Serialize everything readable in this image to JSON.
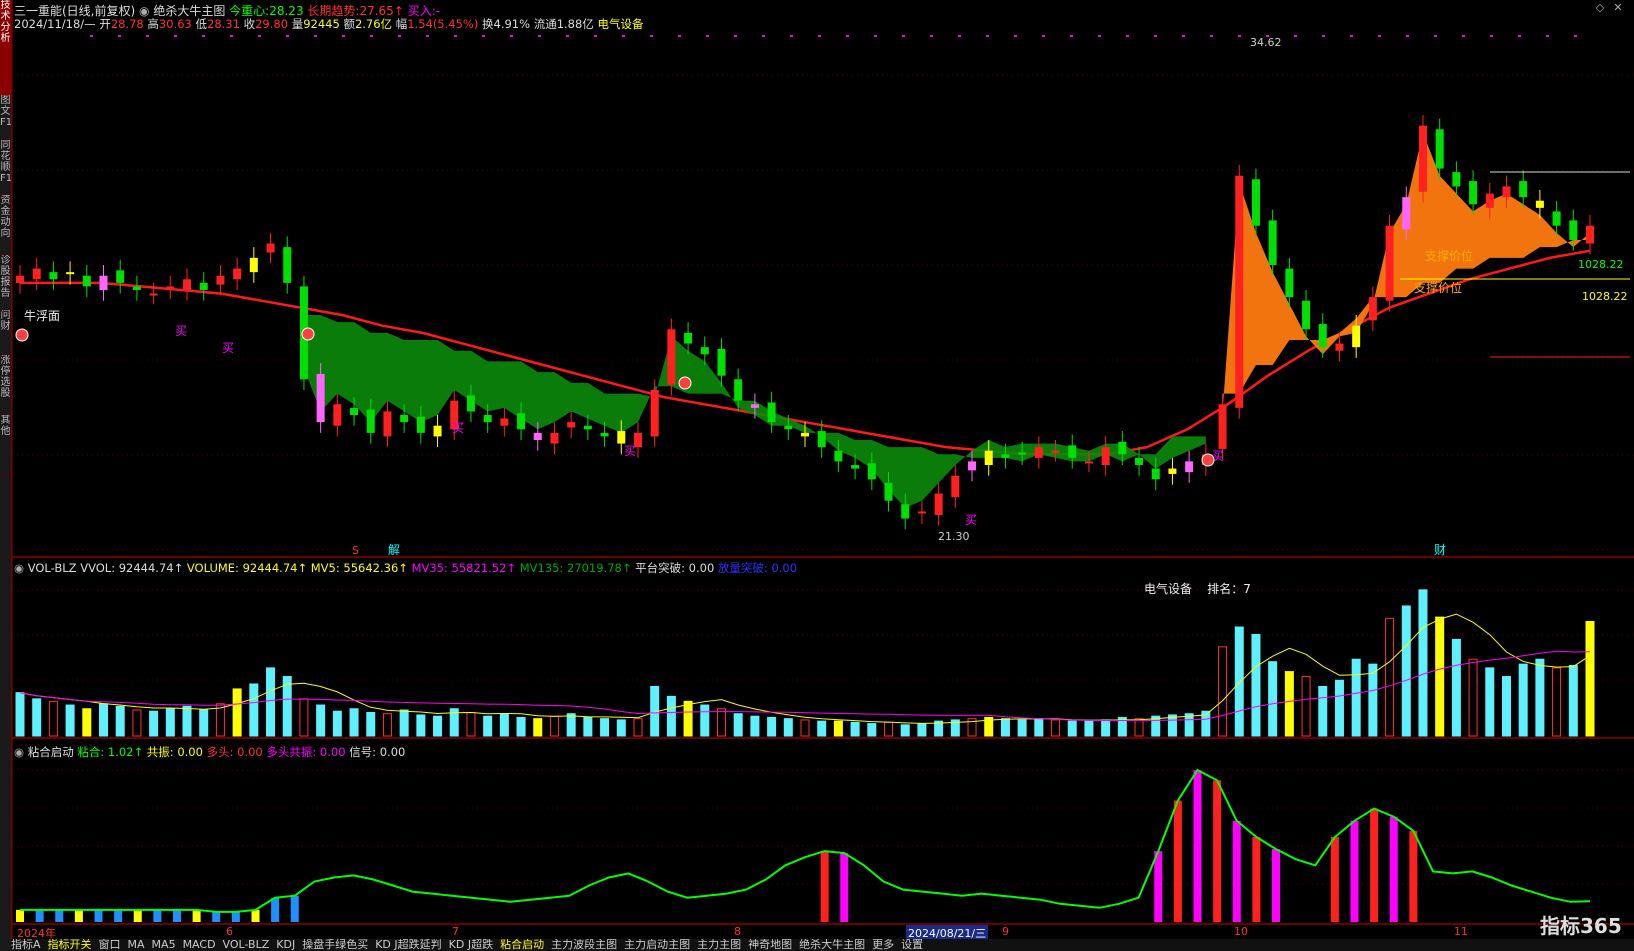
{
  "sidebar": {
    "tabs": [
      "技术分析",
      "图文F10",
      "同花顺F10",
      "资金动向",
      "诊股报告",
      "问财",
      "涨停选股",
      "其他"
    ]
  },
  "header": {
    "stock": "三一重能(日线,前复权)",
    "formula": "绝杀大牛主图",
    "today_label": "今重心:",
    "today_value": "28.23",
    "long_label": "长期趋势:",
    "long_value": "27.65↑",
    "buy_label": "买入:-",
    "line2": {
      "date": "2024/11/18/—",
      "open_l": "开",
      "open": "28.78",
      "high_l": "高",
      "high": "30.63",
      "low_l": "低",
      "low": "28.31",
      "close_l": "收",
      "close": "29.80",
      "vol_l": "量",
      "vol": "92445",
      "amt_l": "额",
      "amt": "2.76亿",
      "chg_l": "幅",
      "chg": "1.54(5.45%)",
      "turn": "换4.91%",
      "float": "流通1.88亿",
      "industry": "电气设备"
    }
  },
  "main_labels": {
    "high_mark": "34.62",
    "low_mark": "21.30",
    "price1": "1028.22",
    "price2": "1028.22",
    "support1": "支撑价位",
    "support2": "支撑价位",
    "niu": "牛浮面",
    "buy": "买",
    "jie": "解",
    "cai": "财",
    "s": "S"
  },
  "vol_panel": {
    "name": "VOL-BLZ",
    "vvol": "VVOL: 92444.74↑",
    "volume": "VOLUME: 92444.74↑",
    "mv5": "MV5: 55642.36↑",
    "mv35": "MV35: 55821.52↑",
    "mv135": "MV135: 27019.78↑",
    "ping": "平台突破: 0.00",
    "jiu": "放量突破: 0.00",
    "sector": "电气设备",
    "rank": "排名：7"
  },
  "ind_panel": {
    "name": "粘合启动",
    "nianhe": "粘合: 1.02↑",
    "gongzhen": "共振: 0.00",
    "duotou": "多头: 0.00",
    "duotougz": "多头共振: 0.00",
    "xinhao": "信号: 0.00"
  },
  "xaxis": {
    "labels": [
      "2024年",
      "6",
      "7",
      "8",
      "2024/08/21/三",
      "9",
      "10",
      "11"
    ]
  },
  "logo": "指标365",
  "bottom_tabs": [
    "指标A",
    "指标开关",
    "窗口",
    "MA",
    "MA5",
    "MACD",
    "VOL-BLZ",
    "KDJ",
    "操盘手绿色买",
    "KD J超跌延判",
    "KD J超跌",
    "粘合启动",
    "主力波段主图",
    "主力启动主图",
    "主力主图",
    "神奇地图",
    "绝杀大牛主图",
    "更多",
    "设置"
  ],
  "chart_data": [
    {
      "type": "candlestick",
      "title": "",
      "series": [
        {
          "name": "close",
          "values": [
            28.4,
            28.6,
            28.3,
            28.5,
            28.1,
            28.4,
            28.2,
            28.0,
            27.9,
            28.1,
            28.3,
            28.0,
            28.4,
            28.6,
            28.9,
            29.3,
            28.2,
            25.5,
            24.3,
            24.8,
            24.5,
            24.0,
            24.6,
            24.3,
            24.0,
            24.2,
            24.9,
            24.6,
            24.3,
            24.4,
            24.1,
            23.8,
            24.0,
            24.3,
            24.1,
            23.9,
            23.7,
            24.0,
            25.2,
            26.9,
            26.5,
            26.2,
            25.6,
            24.9,
            24.7,
            24.3,
            24.1,
            23.9,
            23.6,
            23.2,
            23.0,
            22.7,
            22.1,
            21.6,
            21.8,
            22.3,
            22.8,
            23.2,
            23.5,
            23.3,
            23.4,
            23.6,
            23.5,
            23.3,
            23.2,
            23.6,
            23.4,
            23.1,
            22.7,
            23.0,
            23.2,
            23.4,
            24.8,
            31.2,
            29.8,
            28.7,
            27.8,
            26.9,
            26.4,
            26.5,
            27.0,
            27.8,
            29.8,
            30.6,
            32.6,
            31.4,
            30.9,
            30.4,
            30.7,
            30.9,
            30.6,
            30.3,
            29.8,
            29.4,
            29.8
          ]
        },
        {
          "name": "MA",
          "values": [
            28.2,
            28.2,
            28.2,
            28.1,
            28.0,
            27.9,
            27.7,
            27.5,
            27.3,
            27.0,
            26.8,
            26.5,
            26.2,
            25.9,
            25.6,
            25.3,
            25.0,
            24.8,
            24.6,
            24.4,
            24.2,
            24.0,
            23.8,
            23.6,
            23.5,
            23.4,
            23.4,
            23.4,
            23.6,
            24.1,
            24.8,
            25.6,
            26.3,
            26.9,
            27.5,
            27.9,
            28.3,
            28.6,
            28.9,
            29.1
          ]
        }
      ],
      "ymin": 21.0,
      "ymax": 35.0
    },
    {
      "type": "bar",
      "title": "",
      "series": [
        {
          "name": "VOLUME",
          "values": [
            35000,
            30000,
            28000,
            25000,
            22000,
            26000,
            24000,
            21000,
            20000,
            22000,
            24000,
            21000,
            26000,
            38000,
            42000,
            55000,
            48000,
            30000,
            25000,
            20000,
            22000,
            19000,
            18000,
            21000,
            17000,
            16000,
            22000,
            19000,
            16000,
            18000,
            15000,
            14000,
            16000,
            18000,
            15000,
            14000,
            13000,
            14000,
            40000,
            32000,
            28000,
            25000,
            22000,
            18000,
            16000,
            15000,
            14000,
            13000,
            12000,
            12000,
            11000,
            10000,
            11000,
            9000,
            10000,
            12000,
            13000,
            14000,
            15000,
            14000,
            13000,
            14000,
            13000,
            12000,
            12000,
            13000,
            15000,
            14000,
            16000,
            17000,
            18000,
            20000,
            72000,
            88000,
            82000,
            60000,
            52000,
            48000,
            40000,
            45000,
            62000,
            58000,
            95000,
            105000,
            118000,
            96000,
            78000,
            62000,
            55000,
            48000,
            58000,
            62000,
            55000,
            57000,
            92445
          ]
        }
      ],
      "ymin": 0,
      "ymax": 130000
    },
    {
      "type": "bar",
      "title": "",
      "series": [
        {
          "name": "粘合",
          "values": [
            0.6,
            0.6,
            0.6,
            0.6,
            0.6,
            0.6,
            0.6,
            0.6,
            0.6,
            0.6,
            0.5,
            0.5,
            0.6,
            1.2,
            1.3,
            2.0,
            2.2,
            2.3,
            2.1,
            1.8,
            1.5,
            1.4,
            1.3,
            1.2,
            1.1,
            1.0,
            1.1,
            1.2,
            1.3,
            1.8,
            2.2,
            2.4,
            2.0,
            1.5,
            1.2,
            1.3,
            1.4,
            1.6,
            2.1,
            2.8,
            3.2,
            3.5,
            3.4,
            2.8,
            2.0,
            1.6,
            1.5,
            1.4,
            1.3,
            1.4,
            1.3,
            1.2,
            1.1,
            0.9,
            0.8,
            0.7,
            0.9,
            1.2,
            3.5,
            6.0,
            7.5,
            7.0,
            5.0,
            4.2,
            3.6,
            3.1,
            2.8,
            4.2,
            5.0,
            5.6,
            5.2,
            4.5,
            2.5,
            2.4,
            2.5,
            2.2,
            1.8,
            1.5,
            1.2,
            1.0,
            1.02
          ]
        }
      ],
      "ymin": 0,
      "ymax": 8
    }
  ]
}
